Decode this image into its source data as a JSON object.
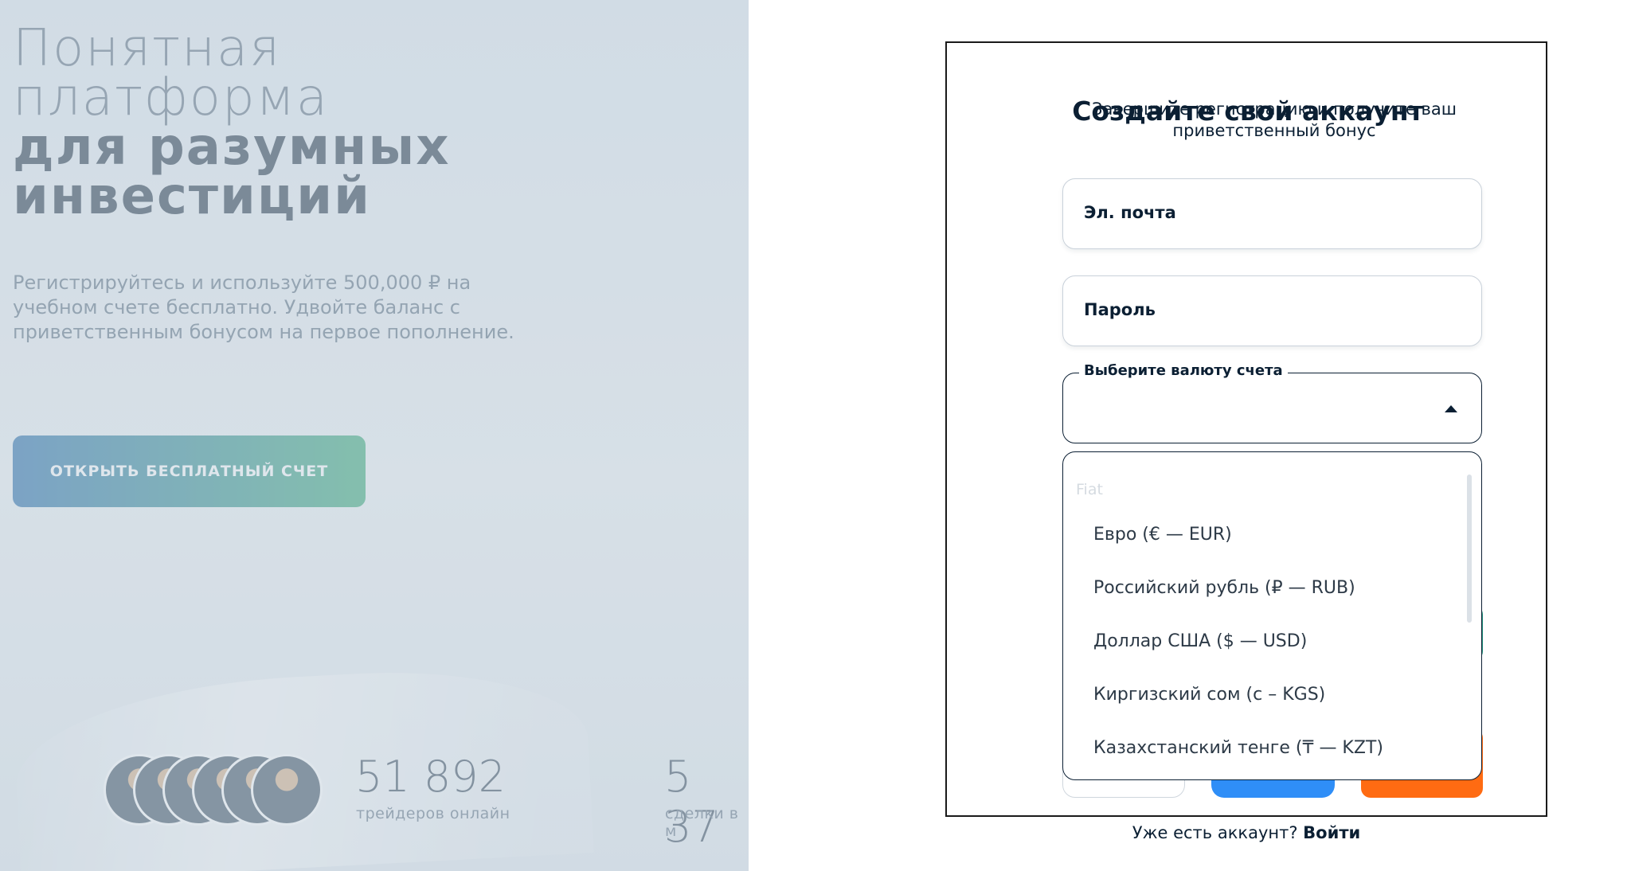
{
  "hero": {
    "title_line1": "Понятная",
    "title_line2": "платформа",
    "title_line3": "для разумных",
    "title_line4": "инвестиций",
    "subtitle": "Регистрируйтесь и используйте 500,000 ₽ на учебном счете бесплатно. Удвойте баланс с приветственным бонусом на первое пополнение.",
    "cta_label": "ОТКРЫТЬ БЕСПЛАТНЫЙ СЧЕТ",
    "stats": [
      {
        "value": "51 892",
        "label": "трейдеров онлайн"
      },
      {
        "value": "5 37",
        "label": "сделки в м"
      }
    ]
  },
  "modal": {
    "title": "Создайте свой аккаунт",
    "subtitle": "Завершите регистрацию и получите ваш приветственный бонус",
    "email_label": "Эл. почта",
    "password_label": "Пароль",
    "currency_label": "Выберите валюту счета",
    "currency_value": "",
    "dropdown": {
      "group": "Fiat",
      "options": [
        "Евро (€ — EUR)",
        "Российский рубль (₽ — RUB)",
        "Доллар США ($ — USD)",
        "Киргизский сом (с – KGS)",
        "Казахстанский тенге (₸ — KZT)"
      ]
    }
  },
  "login": {
    "prompt": "Уже есть аккаунт?",
    "link": "Войти"
  },
  "colors": {
    "text_primary": "#0b1f33",
    "cta_gradient_start": "#5f93c0",
    "cta_gradient_end": "#6cc09a",
    "google_blue": "#2f8ef7",
    "orange": "#ff6b12"
  }
}
